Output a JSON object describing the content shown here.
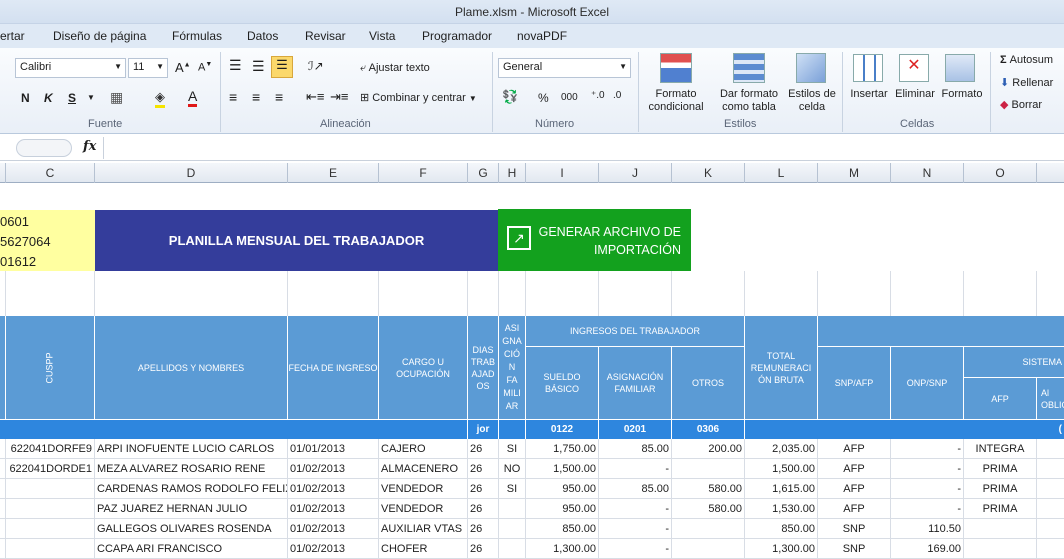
{
  "window": {
    "title": "Plame.xlsm  -  Microsoft Excel"
  },
  "menu": [
    "ertar",
    "Diseño de página",
    "Fórmulas",
    "Datos",
    "Revisar",
    "Vista",
    "Programador",
    "novaPDF"
  ],
  "ribbon": {
    "font_name": "Calibri",
    "font_size": "11",
    "bold": "N",
    "italic": "K",
    "underline": "S",
    "wrap_text": "Ajustar texto",
    "merge_center": "Combinar y centrar",
    "number_format": "General",
    "percent": "%",
    "thousands": "000",
    "cond_format": [
      "Formato",
      "condicional"
    ],
    "table_format": [
      "Dar formato",
      "como tabla"
    ],
    "cell_styles": [
      "Estilos de",
      "celda"
    ],
    "insert": "Insertar",
    "delete": "Eliminar",
    "format": "Formato",
    "autosum": "Autosum",
    "fill": "Rellenar",
    "clear": "Borrar",
    "groups": {
      "font": "Fuente",
      "alignment": "Alineación",
      "number": "Número",
      "styles": "Estilos",
      "cells": "Celdas"
    }
  },
  "formula_bar": {
    "fx": "fx",
    "value": ""
  },
  "columns": [
    "C",
    "D",
    "E",
    "F",
    "G",
    "H",
    "I",
    "J",
    "K",
    "L",
    "M",
    "N",
    "O"
  ],
  "top_left_cells": [
    "0601",
    "5627064",
    "01612"
  ],
  "banner": "PLANILLA MENSUAL DEL TRABAJADOR",
  "export_button": [
    "GENERAR ARCHIVO DE",
    "IMPORTACIÓN"
  ],
  "headers": {
    "cuspp": "CUSPP",
    "names": "APELLIDOS Y NOMBRES",
    "hire_date": "FECHA DE INGRESO",
    "position": "CARGO U OCUPACIÓN",
    "days": [
      "DIAS",
      "TRAB",
      "AJAD",
      "OS"
    ],
    "family": [
      "ASI",
      "GNA",
      "CIÓ",
      "N",
      "FA",
      "MILI",
      "AR"
    ],
    "income": "INGRESOS DEL TRABAJADOR",
    "basic": [
      "SUELDO",
      "BÁSICO"
    ],
    "fam_allow": [
      "ASIGNACIÓN",
      "FAMILIAR"
    ],
    "others": "OTROS",
    "total": [
      "TOTAL",
      "REMUNERACI",
      "ÓN BRUTA"
    ],
    "snp_afp": "SNP/AFP",
    "onp": "ONP/SNP",
    "system": "SISTEMA",
    "afp": "AFP",
    "al": [
      "Al",
      "OBLIC"
    ]
  },
  "codes": {
    "days": "jor",
    "basic": "0122",
    "fam": "0201",
    "others": "0306",
    "o_edge": "("
  },
  "rows": [
    {
      "cuspp": "622041DORFE9",
      "name": "ARPI INOFUENTE LUCIO CARLOS",
      "date": "01/01/2013",
      "pos": "CAJERO",
      "days": "26",
      "fam": "SI",
      "basic": "1,750.00",
      "allow": "85.00",
      "others": "200.00",
      "total": "2,035.00",
      "sys": "AFP",
      "onp": "-",
      "afp": "INTEGRA"
    },
    {
      "cuspp": "622041DORDE1",
      "name": "MEZA ALVAREZ ROSARIO RENE",
      "date": "01/02/2013",
      "pos": "ALMACENERO",
      "days": "26",
      "fam": "NO",
      "basic": "1,500.00",
      "allow": "-",
      "others": "",
      "total": "1,500.00",
      "sys": "AFP",
      "onp": "-",
      "afp": "PRIMA"
    },
    {
      "cuspp": "",
      "name": "CARDENAS RAMOS RODOLFO FELIX",
      "date": "01/02/2013",
      "pos": "VENDEDOR",
      "days": "26",
      "fam": "SI",
      "basic": "950.00",
      "allow": "85.00",
      "others": "580.00",
      "total": "1,615.00",
      "sys": "AFP",
      "onp": "-",
      "afp": "PRIMA"
    },
    {
      "cuspp": "",
      "name": "PAZ JUAREZ HERNAN JULIO",
      "date": "01/02/2013",
      "pos": "VENDEDOR",
      "days": "26",
      "fam": "",
      "basic": "950.00",
      "allow": "-",
      "others": "580.00",
      "total": "1,530.00",
      "sys": "AFP",
      "onp": "-",
      "afp": "PRIMA"
    },
    {
      "cuspp": "",
      "name": "GALLEGOS OLIVARES ROSENDA",
      "date": "01/02/2013",
      "pos": "AUXILIAR VTAS",
      "days": "26",
      "fam": "",
      "basic": "850.00",
      "allow": "-",
      "others": "",
      "total": "850.00",
      "sys": "SNP",
      "onp": "110.50",
      "afp": ""
    },
    {
      "cuspp": "",
      "name": "CCAPA ARI FRANCISCO",
      "date": "01/02/2013",
      "pos": "CHOFER",
      "days": "26",
      "fam": "",
      "basic": "1,300.00",
      "allow": "-",
      "others": "",
      "total": "1,300.00",
      "sys": "SNP",
      "onp": "169.00",
      "afp": ""
    }
  ]
}
